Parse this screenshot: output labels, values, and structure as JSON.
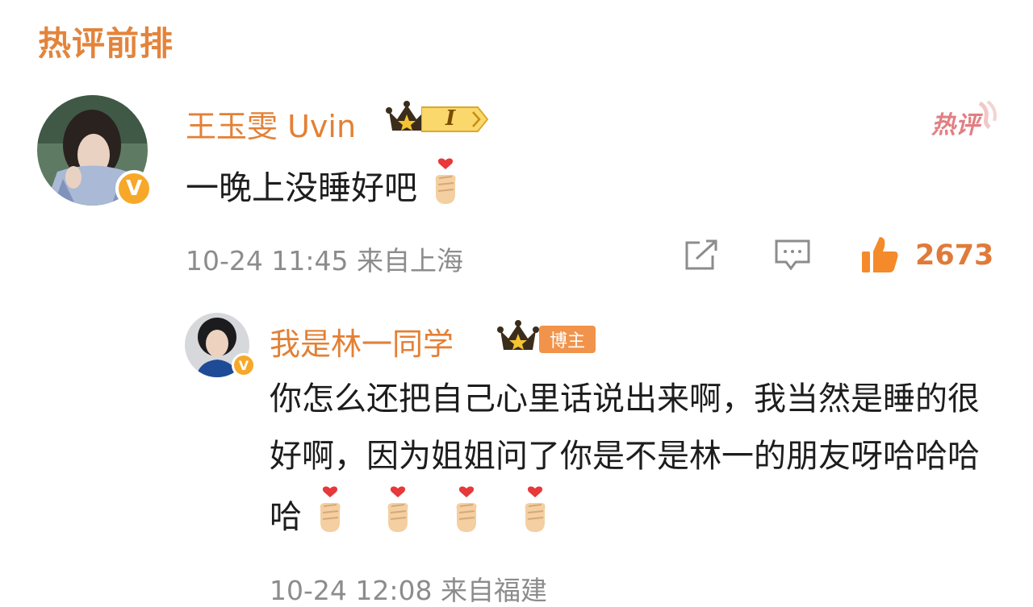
{
  "section_title": "热评前排",
  "hot_badge": "热评",
  "comments": [
    {
      "username": "王玉雯 Uvin",
      "level": "I",
      "text": "一晚上没睡好吧",
      "emoji_count": 1,
      "time": "10-24 11:45",
      "location": "来自上海",
      "likes": "2673"
    },
    {
      "username": "我是林一同学",
      "tag": "博主",
      "text": "你怎么还把自己心里话说出来啊，我当然是睡的很好啊，因为姐姐问了你是不是林一的朋友呀哈哈哈哈",
      "emoji_count": 4,
      "time": "10-24 12:08",
      "location": "来自福建"
    }
  ],
  "colors": {
    "accent": "#e38035",
    "text": "#1d1d1d",
    "meta": "#8c8c8c",
    "hot": "#e27e82"
  },
  "icons": [
    "share-icon",
    "comment-icon",
    "like-icon",
    "crown-icon",
    "verified-icon",
    "finger-heart-emoji"
  ]
}
